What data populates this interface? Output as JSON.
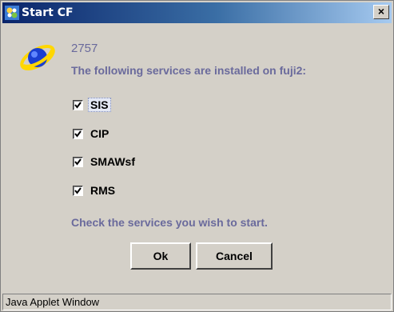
{
  "window": {
    "title": "Start CF",
    "close_label": "×"
  },
  "dialog": {
    "line1": "2757",
    "line2": "The following services are installed on fuji2:",
    "services": [
      {
        "label": "SIS",
        "checked": true
      },
      {
        "label": "CIP",
        "checked": true
      },
      {
        "label": "SMAWsf",
        "checked": true
      },
      {
        "label": "RMS",
        "checked": true
      }
    ],
    "instruction": "Check the services you wish to start."
  },
  "buttons": {
    "ok": "Ok",
    "cancel": "Cancel"
  },
  "statusbar": {
    "text": "Java Applet Window"
  },
  "colors": {
    "title_gradient_start": "#0a246a",
    "title_gradient_end": "#a6caf0",
    "prompt_text": "#6a6a9c",
    "face": "#d4d0c8"
  }
}
